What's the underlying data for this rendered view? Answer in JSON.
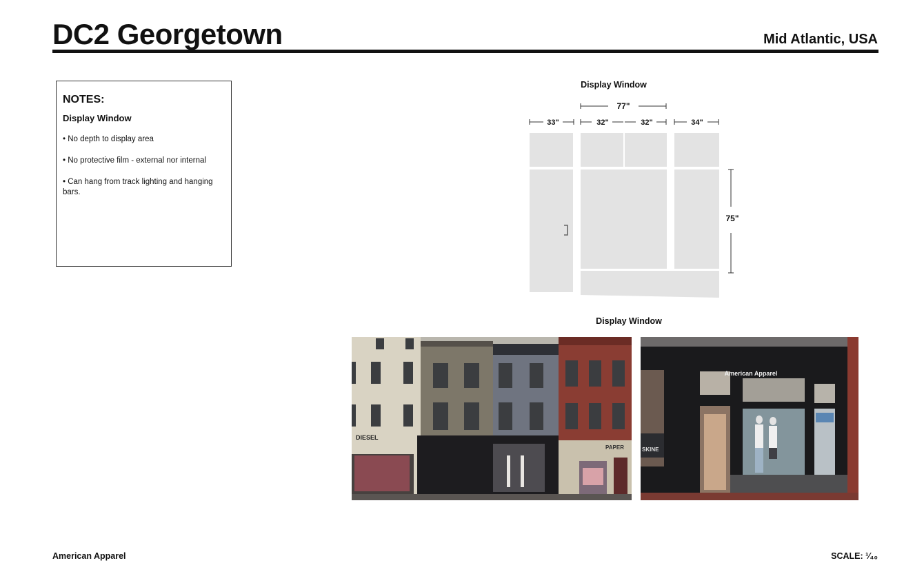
{
  "header": {
    "title": "DC2 Georgetown",
    "region": "Mid Atlantic, USA"
  },
  "notes": {
    "heading": "NOTES:",
    "subheading": "Display Window",
    "items": [
      "No depth to display area",
      "No protective film - external nor internal",
      "Can hang from track lighting and hanging bars."
    ]
  },
  "diagram": {
    "title": "Display Window",
    "total_width": "77\"",
    "widths": [
      "33\"",
      "32\"",
      "32\"",
      "34\""
    ],
    "height": "75\""
  },
  "photos": {
    "title": "Display Window",
    "storefront_sign": "American Apparel",
    "neighbor_signs": [
      "DIESEL",
      "PAPER",
      "SKINE"
    ]
  },
  "footer": {
    "brand": "American Apparel",
    "scale": "SCALE: ¹⁄₄₀"
  }
}
